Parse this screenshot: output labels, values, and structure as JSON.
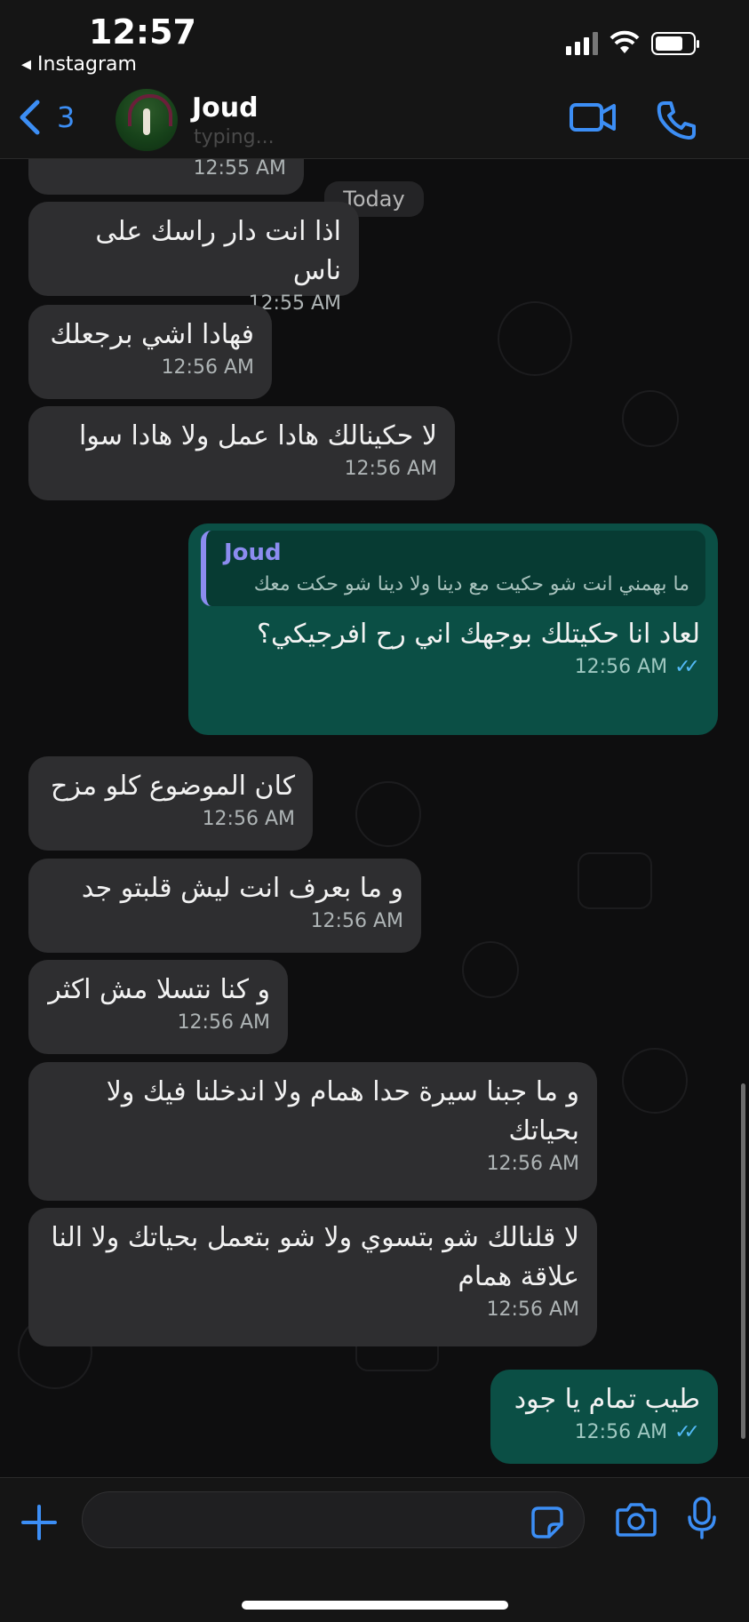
{
  "status_bar": {
    "time": "12:57",
    "back_app": "◂ Instagram"
  },
  "header": {
    "back_count": "3",
    "contact_name": "Joud",
    "contact_status": "typing..."
  },
  "date_pill": "Today",
  "messages": [
    {
      "dir": "in",
      "text": "",
      "time": "12:55 AM"
    },
    {
      "dir": "in",
      "text": "اذا انت دار راسك على ناس",
      "time": "12:55 AM"
    },
    {
      "dir": "in",
      "text": "فهادا اشي برجعلك",
      "time": "12:56 AM"
    },
    {
      "dir": "in",
      "text": "لا حكينالك هادا عمل ولا هادا سوا",
      "time": "12:56 AM"
    },
    {
      "dir": "out",
      "quote_name": "Joud",
      "quote_text": "ما بهمني انت شو حكيت مع دينا ولا دينا شو حكت معك",
      "text": "لعاد انا حكيتلك بوجهك اني رح افرجيكي؟",
      "time": "12:56 AM"
    },
    {
      "dir": "in",
      "text": "كان الموضوع كلو مزح",
      "time": "12:56 AM"
    },
    {
      "dir": "in",
      "text": "و ما بعرف انت ليش قلبتو جد",
      "time": "12:56 AM"
    },
    {
      "dir": "in",
      "text": "و كنا نتسلا مش اكثر",
      "time": "12:56 AM"
    },
    {
      "dir": "in",
      "text": "و ما جبنا سيرة حدا همام ولا اندخلنا فيك ولا بحياتك",
      "time": "12:56 AM"
    },
    {
      "dir": "in",
      "text": "لا قلنالك شو بتسوي ولا شو بتعمل بحياتك ولا النا علاقة همام",
      "time": "12:56 AM"
    },
    {
      "dir": "out",
      "text": "طيب تمام يا جود",
      "time": "12:56 AM"
    }
  ],
  "composer": {
    "placeholder": ""
  },
  "colors": {
    "accent": "#3c8ef5",
    "incoming": "#2e2e30",
    "outgoing": "#0b4f45",
    "read_ticks": "#53b9f5"
  }
}
